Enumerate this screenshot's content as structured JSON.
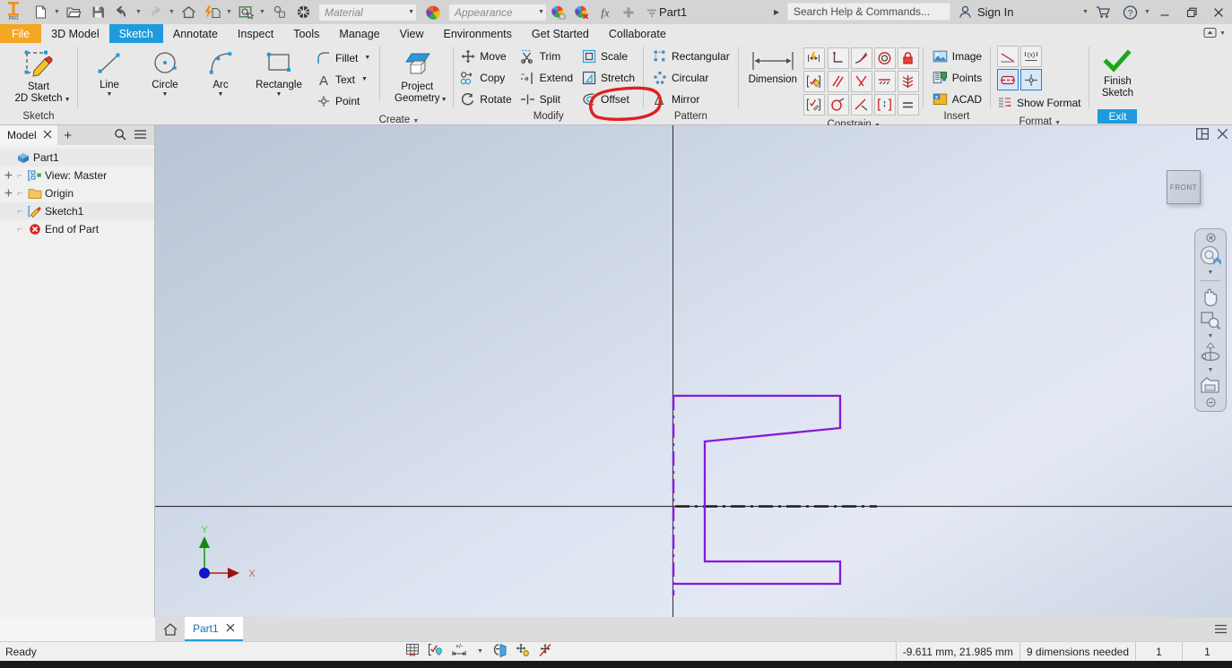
{
  "app": {
    "title": "Part1",
    "logo": "inventor-pro-logo"
  },
  "titlebar": {
    "quick_access": [
      {
        "name": "new-file",
        "icon": "file-icon",
        "dropdown": true
      },
      {
        "name": "open-file",
        "icon": "folder-open-icon",
        "dropdown": false
      },
      {
        "name": "save",
        "icon": "floppy-disk-icon",
        "dropdown": false
      },
      {
        "name": "undo",
        "icon": "undo-arrow-icon",
        "dropdown": true
      },
      {
        "name": "redo",
        "icon": "redo-arrow-icon",
        "dropdown": true
      },
      {
        "name": "home",
        "icon": "home-icon",
        "dropdown": false
      },
      {
        "name": "update",
        "icon": "lightning-bolt-icon",
        "dropdown": true
      },
      {
        "name": "select",
        "icon": "select-cursor-icon",
        "dropdown": true
      },
      {
        "name": "return",
        "icon": "return-icon",
        "dropdown": false
      },
      {
        "name": "appearance-sphere",
        "icon": "checker-sphere-icon",
        "dropdown": false
      }
    ],
    "material_value": "Material",
    "appearance_value": "Appearance",
    "extra_buttons": [
      {
        "name": "adjust-appearance",
        "icon": "color-wheel-down-icon"
      },
      {
        "name": "clear-appearance",
        "icon": "color-wheel-x-icon"
      },
      {
        "name": "parameters",
        "icon": "fx-icon"
      },
      {
        "name": "add-command",
        "icon": "plus-icon"
      },
      {
        "name": "customize-quick-access",
        "icon": "chevron-down-icon"
      }
    ],
    "search_placeholder": "Search Help & Commands...",
    "sign_in": "Sign In",
    "cart": "cart-icon",
    "help": "help-icon",
    "window_buttons": {
      "minimize": "minimize-icon",
      "restore": "restore-icon",
      "close": "close-icon"
    }
  },
  "ribbon_tabs": {
    "items": [
      {
        "label": "File",
        "style": "file"
      },
      {
        "label": "3D Model",
        "style": "normal"
      },
      {
        "label": "Sketch",
        "style": "active"
      },
      {
        "label": "Annotate",
        "style": "normal"
      },
      {
        "label": "Inspect",
        "style": "normal"
      },
      {
        "label": "Tools",
        "style": "normal"
      },
      {
        "label": "Manage",
        "style": "normal"
      },
      {
        "label": "View",
        "style": "normal"
      },
      {
        "label": "Environments",
        "style": "normal"
      },
      {
        "label": "Get Started",
        "style": "normal"
      },
      {
        "label": "Collaborate",
        "style": "normal"
      }
    ],
    "collapse": "ribbon-collapse-icon"
  },
  "ribbon": {
    "panels": [
      {
        "name": "sketch",
        "title": "Sketch",
        "buttons": [
          {
            "label": "Start\n2D Sketch",
            "line1": "Start",
            "line2": "2D Sketch",
            "icon": "start-2d-sketch-icon",
            "dropdown": true
          }
        ]
      },
      {
        "name": "create",
        "title": "Create",
        "dropdown": true,
        "big": [
          {
            "label": "Line",
            "icon": "line-icon",
            "dropdown": true
          },
          {
            "label": "Circle",
            "icon": "circle-icon",
            "dropdown": true
          },
          {
            "label": "Arc",
            "icon": "arc-icon",
            "dropdown": true
          },
          {
            "label": "Rectangle",
            "icon": "rectangle-icon",
            "dropdown": true
          }
        ],
        "small": [
          {
            "label": "Fillet",
            "icon": "fillet-icon",
            "dropdown": true
          },
          {
            "label": "Text",
            "icon": "text-icon",
            "dropdown": true
          },
          {
            "label": "Point",
            "icon": "point-icon",
            "dropdown": false
          }
        ],
        "project": {
          "line1": "Project",
          "line2": "Geometry",
          "icon": "project-geometry-icon",
          "dropdown": true
        }
      },
      {
        "name": "modify",
        "title": "Modify",
        "col1": [
          {
            "label": "Move",
            "icon": "move-icon"
          },
          {
            "label": "Copy",
            "icon": "copy-icon"
          },
          {
            "label": "Rotate",
            "icon": "rotate-icon"
          }
        ],
        "col2": [
          {
            "label": "Trim",
            "icon": "trim-scissors-icon"
          },
          {
            "label": "Extend",
            "icon": "extend-icon"
          },
          {
            "label": "Split",
            "icon": "split-icon"
          }
        ],
        "col3": [
          {
            "label": "Scale",
            "icon": "scale-icon"
          },
          {
            "label": "Stretch",
            "icon": "stretch-icon"
          },
          {
            "label": "Offset",
            "icon": "offset-icon"
          }
        ]
      },
      {
        "name": "pattern",
        "title": "Pattern",
        "items": [
          {
            "label": "Rectangular",
            "icon": "rectangular-pattern-icon",
            "highlighted": false
          },
          {
            "label": "Circular",
            "icon": "circular-pattern-icon",
            "highlighted": false
          },
          {
            "label": "Mirror",
            "icon": "mirror-icon",
            "highlighted": true
          }
        ],
        "annotation": {
          "shape": "hand-drawn-ellipse",
          "color": "#e02020",
          "target": "Mirror"
        }
      },
      {
        "name": "constrain",
        "title": "Constrain",
        "dropdown": true,
        "dimension": {
          "label": "Dimension",
          "icon": "dimension-icon"
        },
        "left_stack": [
          {
            "name": "auto-dimension-icon"
          },
          {
            "name": "show-constraints-icon"
          },
          {
            "name": "constraint-settings-icon"
          }
        ],
        "grid": [
          [
            {
              "name": "perpendicular-constraint-icon"
            },
            {
              "name": "tangent-constraint-icon"
            },
            {
              "name": "concentric-constraint-icon"
            },
            {
              "name": "fix-constraint-icon"
            }
          ],
          [
            {
              "name": "parallel-constraint-icon"
            },
            {
              "name": "coincident-constraint-icon"
            },
            {
              "name": "collinear-constraint-icon"
            },
            {
              "name": "symmetric-constraint-icon"
            }
          ],
          [
            {
              "name": "smooth-constraint-icon"
            },
            {
              "name": "horizontal-constraint-icon"
            },
            {
              "name": "vertical-constraint-icon"
            },
            {
              "name": "equal-constraint-icon"
            }
          ]
        ]
      },
      {
        "name": "insert",
        "title": "Insert",
        "items": [
          {
            "label": "Image",
            "icon": "image-icon"
          },
          {
            "label": "Points",
            "icon": "import-points-icon"
          },
          {
            "label": "ACAD",
            "icon": "acad-import-icon"
          }
        ]
      },
      {
        "name": "format",
        "title": "Format",
        "dropdown": true,
        "grid": [
          [
            {
              "name": "construction-line-icon",
              "selected": false
            },
            {
              "name": "driven-dimension-icon",
              "selected": false
            }
          ],
          [
            {
              "name": "centerline-icon",
              "selected": true
            },
            {
              "name": "center-point-icon",
              "selected": true
            }
          ]
        ],
        "show_format": {
          "label": "Show Format",
          "icon": "show-format-icon"
        }
      },
      {
        "name": "exit",
        "finish": {
          "line1": "Finish",
          "line2": "Sketch",
          "icon": "green-check-icon"
        },
        "exit_label": "Exit"
      }
    ]
  },
  "browser": {
    "tab_label": "Model",
    "tab_close": "close-icon",
    "add": "plus-icon",
    "search": "search-icon",
    "menu": "hamburger-menu-icon",
    "tree": [
      {
        "label": "Part1",
        "icon": "part-cube-icon",
        "indent": 0,
        "expander": "none"
      },
      {
        "label": "View: Master",
        "icon": "view-master-icon",
        "indent": 1,
        "expander": "plus"
      },
      {
        "label": "Origin",
        "icon": "folder-icon",
        "indent": 1,
        "expander": "plus"
      },
      {
        "label": "Sketch1",
        "icon": "sketch-icon",
        "indent": 1,
        "expander": "none"
      },
      {
        "label": "End of Part",
        "icon": "end-of-part-icon",
        "indent": 1,
        "expander": "none"
      }
    ]
  },
  "canvas": {
    "header_buttons": [
      {
        "name": "split-view-icon"
      },
      {
        "name": "close-view-icon"
      }
    ],
    "view_cube_label": "FRONT",
    "nav_bar": [
      {
        "name": "navbar-close-icon"
      },
      {
        "name": "steering-wheel-icon",
        "dropdown": true
      },
      {
        "name": "pan-hand-icon",
        "dropdown": false
      },
      {
        "name": "zoom-window-icon",
        "dropdown": true
      },
      {
        "name": "orbit-icon",
        "dropdown": true
      },
      {
        "name": "look-at-camera-icon",
        "dropdown": false
      },
      {
        "name": "navbar-minimize-icon"
      }
    ],
    "axis_labels": {
      "x": "X",
      "y": "Y"
    },
    "sketch_color": "#8818d8",
    "sketch_name": "c-channel-profile"
  },
  "doc_tabs": {
    "home": "home-icon",
    "tabs": [
      {
        "label": "Part1",
        "active": true,
        "close": "close-icon"
      }
    ],
    "menu": "document-tabs-menu-icon"
  },
  "status_bar": {
    "message": "Ready",
    "tools": [
      {
        "name": "snap-to-grid-icon"
      },
      {
        "name": "show-all-constraints-icon"
      },
      {
        "name": "show-all-dimensions-icon",
        "dropdown": true
      },
      {
        "name": "slice-graphics-icon"
      },
      {
        "name": "show-all-degrees-of-freedom-icon"
      },
      {
        "name": "hide-all-degrees-of-freedom-icon"
      }
    ],
    "coordinates": "-9.611 mm, 21.985 mm",
    "dimensions_needed": "9 dimensions needed",
    "count_1": "1",
    "count_2": "1"
  }
}
